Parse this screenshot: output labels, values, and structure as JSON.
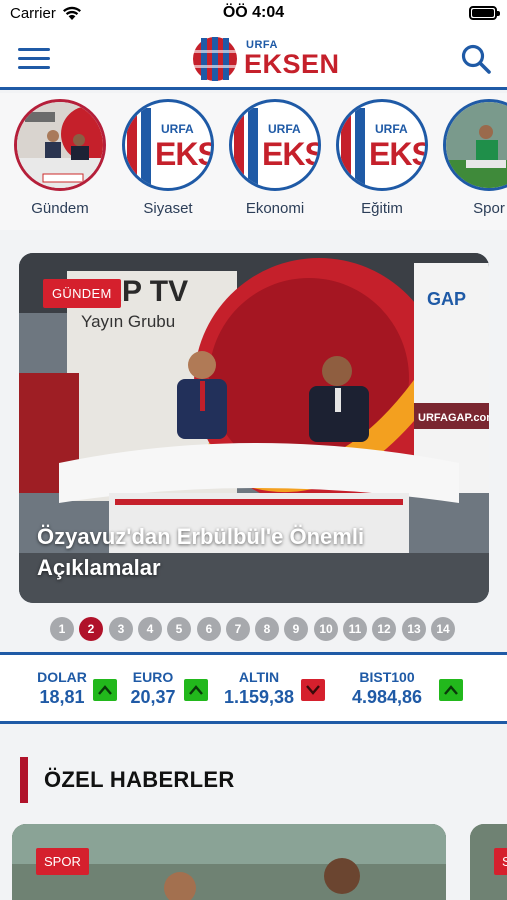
{
  "status_bar": {
    "carrier": "Carrier",
    "time": "ÖÖ 4:04"
  },
  "header": {
    "logo_small": "URFA",
    "logo_big": "EKSEN"
  },
  "categories": [
    {
      "label": "Gündem",
      "image": "thumbnail-photo"
    },
    {
      "label": "Siyaset",
      "image": "urfa-eksen-logo"
    },
    {
      "label": "Ekonomi",
      "image": "urfa-eksen-logo"
    },
    {
      "label": "Eğitim",
      "image": "urfa-eksen-logo"
    },
    {
      "label": "Spor",
      "image": "thumbnail-photo"
    }
  ],
  "category_logo": {
    "small": "URFA",
    "big": "EKS"
  },
  "hero": {
    "badge": "GÜNDEM",
    "title": "Özyavuz'dan Erbülbül'e Önemli Açıklamalar",
    "backdrop_text": {
      "brand": "GAP TV",
      "tagline": "Yayın Grubu",
      "sign": "GAP",
      "banner": "URFAGAP.com"
    }
  },
  "pager": {
    "pages": [
      "1",
      "2",
      "3",
      "4",
      "5",
      "6",
      "7",
      "8",
      "9",
      "10",
      "11",
      "12",
      "13",
      "14"
    ],
    "active": "2"
  },
  "market": [
    {
      "name": "DOLAR",
      "value": "18,81",
      "trend": "up"
    },
    {
      "name": "EURO",
      "value": "20,37",
      "trend": "up"
    },
    {
      "name": "ALTIN",
      "value": "1.159,38",
      "trend": "down"
    },
    {
      "name": "BIST100",
      "value": "4.984,86",
      "trend": "up"
    }
  ],
  "section": {
    "title": "ÖZEL HABERLER"
  },
  "cards": [
    {
      "badge": "SPOR"
    },
    {
      "badge": "SPOR"
    }
  ],
  "colors": {
    "brand_blue": "#1f5aa6",
    "brand_red": "#c5202b",
    "accent": "#b0122a",
    "up": "#22b81c",
    "down": "#d5202d"
  }
}
